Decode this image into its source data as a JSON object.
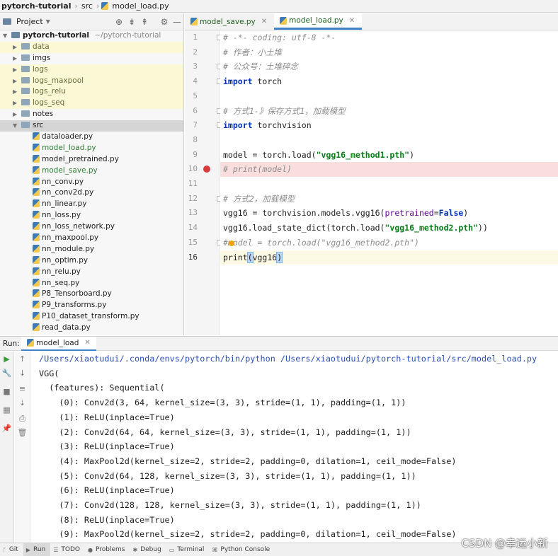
{
  "breadcrumb": [
    "pytorch-tutorial",
    "src",
    "model_load.py"
  ],
  "project_panel": {
    "title": "Project",
    "tree": [
      {
        "label": "pytorch-tutorial",
        "suffix": "~/pytorch-tutorial",
        "kind": "root"
      },
      {
        "label": "data",
        "kind": "folder",
        "style": "excluded"
      },
      {
        "label": "imgs",
        "kind": "folder",
        "style": "normal"
      },
      {
        "label": "logs",
        "kind": "folder",
        "style": "excluded"
      },
      {
        "label": "logs_maxpool",
        "kind": "folder",
        "style": "excluded"
      },
      {
        "label": "logs_relu",
        "kind": "folder",
        "style": "excluded"
      },
      {
        "label": "logs_seq",
        "kind": "folder",
        "style": "excluded"
      },
      {
        "label": "notes",
        "kind": "folder",
        "style": "normal"
      },
      {
        "label": "src",
        "kind": "folder-open",
        "style": "selected"
      },
      {
        "label": "dataloader.py",
        "kind": "file",
        "style": "normal"
      },
      {
        "label": "model_load.py",
        "kind": "file",
        "style": "green"
      },
      {
        "label": "model_pretrained.py",
        "kind": "file",
        "style": "normal"
      },
      {
        "label": "model_save.py",
        "kind": "file",
        "style": "green"
      },
      {
        "label": "nn_conv.py",
        "kind": "file",
        "style": "normal"
      },
      {
        "label": "nn_conv2d.py",
        "kind": "file",
        "style": "normal"
      },
      {
        "label": "nn_linear.py",
        "kind": "file",
        "style": "normal"
      },
      {
        "label": "nn_loss.py",
        "kind": "file",
        "style": "normal"
      },
      {
        "label": "nn_loss_network.py",
        "kind": "file",
        "style": "normal"
      },
      {
        "label": "nn_maxpool.py",
        "kind": "file",
        "style": "normal"
      },
      {
        "label": "nn_module.py",
        "kind": "file",
        "style": "normal"
      },
      {
        "label": "nn_optim.py",
        "kind": "file",
        "style": "normal"
      },
      {
        "label": "nn_relu.py",
        "kind": "file",
        "style": "normal"
      },
      {
        "label": "nn_seq.py",
        "kind": "file",
        "style": "normal"
      },
      {
        "label": "P8_Tensorboard.py",
        "kind": "file",
        "style": "normal"
      },
      {
        "label": "P9_transforms.py",
        "kind": "file",
        "style": "normal"
      },
      {
        "label": "P10_dataset_transform.py",
        "kind": "file",
        "style": "normal"
      },
      {
        "label": "read_data.py",
        "kind": "file",
        "style": "normal"
      }
    ]
  },
  "editor": {
    "tabs": [
      {
        "label": "model_save.py",
        "active": false
      },
      {
        "label": "model_load.py",
        "active": true
      }
    ],
    "lines": [
      {
        "n": "1",
        "t": "# -*- coding: utf-8 -*-"
      },
      {
        "n": "2",
        "t": "# 作者：小土堆"
      },
      {
        "n": "3",
        "t": "# 公众号：土堆碎念"
      },
      {
        "n": "4",
        "t": "import torch"
      },
      {
        "n": "5",
        "t": ""
      },
      {
        "n": "6",
        "t": "# 方式1-》保存方式1，加载模型"
      },
      {
        "n": "7",
        "t": "import torchvision"
      },
      {
        "n": "8",
        "t": ""
      },
      {
        "n": "9",
        "t": "model = torch.load(\"vgg16_method1.pth\")"
      },
      {
        "n": "10",
        "t": "# print(model)"
      },
      {
        "n": "11",
        "t": ""
      },
      {
        "n": "12",
        "t": "# 方式2，加载模型"
      },
      {
        "n": "13",
        "t": "vgg16 = torchvision.models.vgg16(pretrained=False)"
      },
      {
        "n": "14",
        "t": "vgg16.load_state_dict(torch.load(\"vgg16_method2.pth\"))"
      },
      {
        "n": "15",
        "t": "#model = torch.load(\"vgg16_method2.pth\")"
      },
      {
        "n": "16",
        "t": "print(vgg16)"
      }
    ],
    "breakpoint_line": "10",
    "current_line": "16"
  },
  "run_panel": {
    "label": "Run:",
    "tab": "model_load",
    "output": [
      "/Users/xiaotudui/.conda/envs/pytorch/bin/python /Users/xiaotudui/pytorch-tutorial/src/model_load.py",
      "VGG(",
      "  (features): Sequential(",
      "    (0): Conv2d(3, 64, kernel_size=(3, 3), stride=(1, 1), padding=(1, 1))",
      "    (1): ReLU(inplace=True)",
      "    (2): Conv2d(64, 64, kernel_size=(3, 3), stride=(1, 1), padding=(1, 1))",
      "    (3): ReLU(inplace=True)",
      "    (4): MaxPool2d(kernel_size=2, stride=2, padding=0, dilation=1, ceil_mode=False)",
      "    (5): Conv2d(64, 128, kernel_size=(3, 3), stride=(1, 1), padding=(1, 1))",
      "    (6): ReLU(inplace=True)",
      "    (7): Conv2d(128, 128, kernel_size=(3, 3), stride=(1, 1), padding=(1, 1))",
      "    (8): ReLU(inplace=True)",
      "    (9): MaxPool2d(kernel_size=2, stride=2, padding=0, dilation=1, ceil_mode=False)"
    ]
  },
  "bottom_bar": [
    {
      "label": "Git",
      "icon": "git-icon"
    },
    {
      "label": "Run",
      "icon": "run-icon",
      "active": true
    },
    {
      "label": "TODO",
      "icon": "todo-icon"
    },
    {
      "label": "Problems",
      "icon": "problems-icon"
    },
    {
      "label": "Debug",
      "icon": "debug-icon"
    },
    {
      "label": "Terminal",
      "icon": "terminal-icon"
    },
    {
      "label": "Python Console",
      "icon": "python-console-icon"
    }
  ],
  "watermark": "CSDN @幸运小新"
}
